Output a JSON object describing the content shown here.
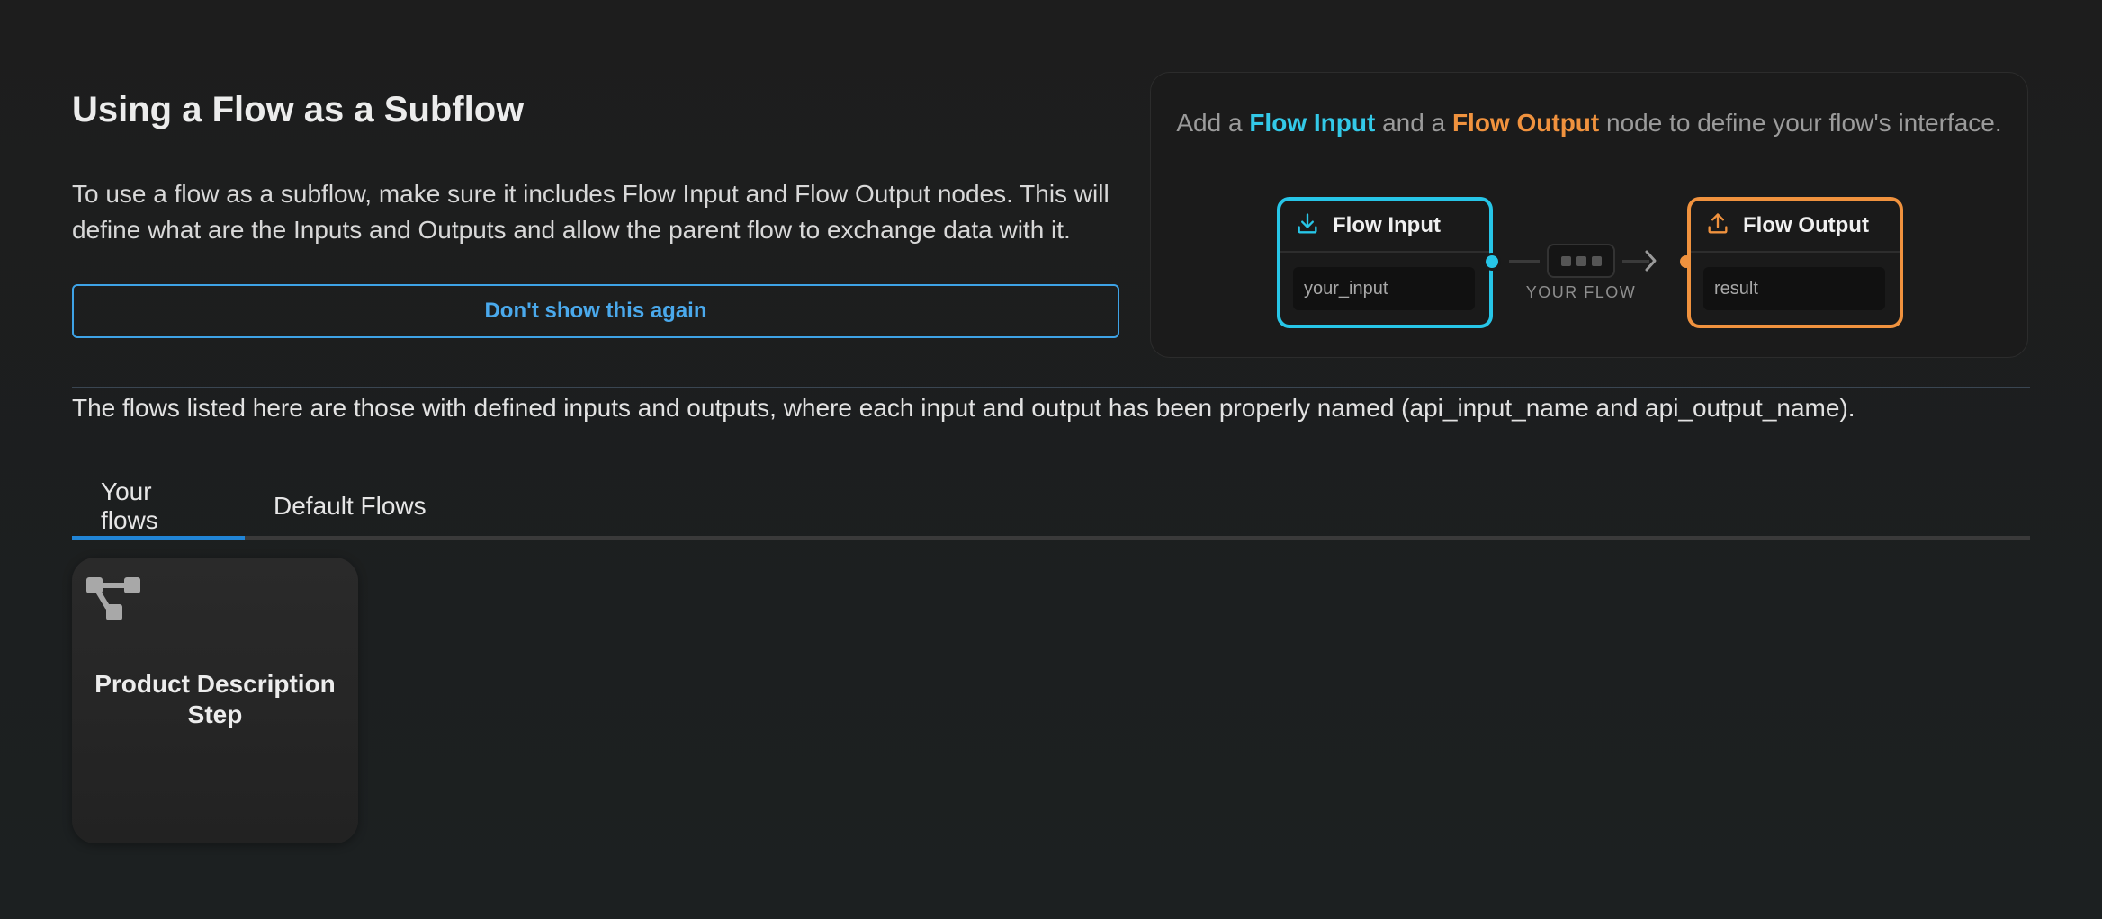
{
  "header": {
    "title": "Using a Flow as a Subflow",
    "intro": "To use a flow as a subflow, make sure it includes Flow Input and Flow Output nodes. This will define what are the Inputs and Outputs and allow the parent flow to exchange data with it.",
    "dismiss_label": "Don't show this again"
  },
  "illustration": {
    "caption_pre": "Add a ",
    "caption_input": "Flow Input",
    "caption_mid": " and a ",
    "caption_output": "Flow Output",
    "caption_post": " node to define your flow's interface.",
    "input_node": {
      "title": "Flow Input",
      "field": "your_input",
      "icon": "download-icon"
    },
    "output_node": {
      "title": "Flow Output",
      "field": "result",
      "icon": "upload-icon"
    },
    "flow_label": "YOUR FLOW",
    "colors": {
      "input": "#27c6e8",
      "output": "#f0923e"
    }
  },
  "note": "The flows listed here are those with defined inputs and outputs, where each input and output has been properly named (api_input_name and api_output_name).",
  "tabs": [
    {
      "label": "Your flows",
      "active": true
    },
    {
      "label": "Default Flows",
      "active": false
    }
  ],
  "flows": [
    {
      "title": "Product Description Step",
      "icon": "flow-icon"
    }
  ],
  "colors": {
    "accent": "#2185d6",
    "button": "#3ea3e6"
  }
}
